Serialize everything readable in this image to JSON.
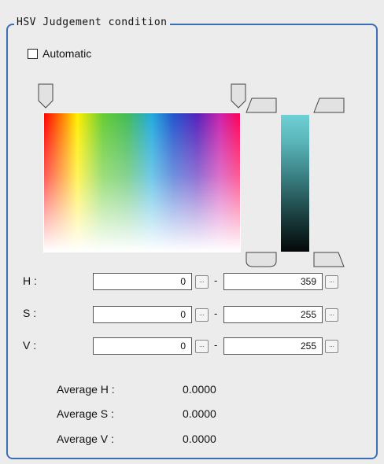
{
  "group": {
    "title": "HSV Judgement condition"
  },
  "automatic": {
    "label": "Automatic",
    "checked": false
  },
  "rows": [
    {
      "label": "H :",
      "min": "0",
      "max": "359"
    },
    {
      "label": "S :",
      "min": "0",
      "max": "255"
    },
    {
      "label": "V :",
      "min": "0",
      "max": "255"
    }
  ],
  "button_label": "...",
  "separator": "-",
  "averages": [
    {
      "label": "Average H :",
      "value": "0.0000"
    },
    {
      "label": "Average S :",
      "value": "0.0000"
    },
    {
      "label": "Average V :",
      "value": "0.0000"
    }
  ],
  "colors": {
    "accent": "#3d6eb4"
  }
}
